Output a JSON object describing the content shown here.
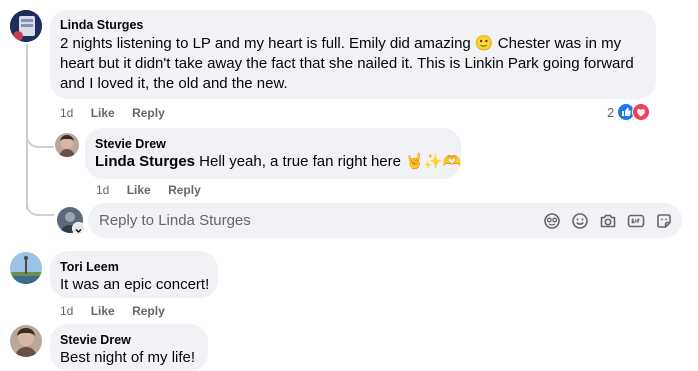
{
  "comments": [
    {
      "author": "Linda Sturges",
      "text_lines": [
        "2 nights listening to LP and my heart is full. Emily did amazing 🙂 Chester was in my",
        "heart but it didn't take away the fact that she nailed it. This is Linkin Park going forward",
        "and I loved it, the old and the new."
      ],
      "time": "1d",
      "like": "Like",
      "reply": "Reply",
      "reaction_count": "2"
    },
    {
      "author": "Stevie Drew",
      "mention": "Linda Sturges",
      "text": " Hell yeah, a true fan right here 🤘✨🫶",
      "time": "1d",
      "like": "Like",
      "reply": "Reply"
    },
    {
      "author": "Tori Leem",
      "text": "It was an epic concert!",
      "time": "1d",
      "like": "Like",
      "reply": "Reply"
    },
    {
      "author": "Stevie Drew",
      "text": "Best night of my life!"
    }
  ],
  "reply_box": {
    "placeholder": "Reply to Linda Sturges"
  },
  "colors": {
    "bubble": "#f0f2f5",
    "meta": "#65676b",
    "like_blue": "#1877f2",
    "love_red": "#f33e58"
  },
  "icons": [
    "avatar-sticker-icon",
    "emoji-icon",
    "camera-icon",
    "gif-icon",
    "sticker-icon",
    "like-reaction-icon",
    "love-reaction-icon"
  ]
}
